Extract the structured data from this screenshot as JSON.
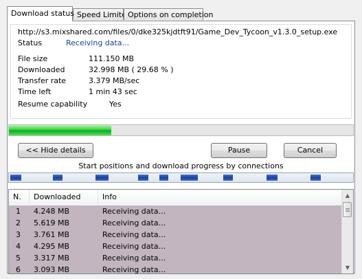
{
  "tabs": [
    {
      "label": "Download status",
      "active": true
    },
    {
      "label": "Speed Limiter",
      "active": false
    },
    {
      "label": "Options on completion",
      "active": false
    }
  ],
  "info": {
    "url": "http://s3.mixshared.com/files/0/dke325kjdtft91/Game_Dev_Tycoon_v1.3.0_setup.exe",
    "status_label": "Status",
    "status_value": "Receiving data...",
    "file_size_label": "File size",
    "file_size_value": "111.150  MB",
    "downloaded_label": "Downloaded",
    "downloaded_value": "32.998  MB  ( 29.68 % )",
    "transfer_rate_label": "Transfer rate",
    "transfer_rate_value": "3.379  MB/sec",
    "time_left_label": "Time left",
    "time_left_value": "1 min 43 sec",
    "resume_label": "Resume capability",
    "resume_value": "Yes"
  },
  "progress": {
    "fraction": 0.2968,
    "color": "#06b025"
  },
  "buttons": {
    "hide_details": "<< Hide details",
    "pause": "Pause",
    "cancel": "Cancel"
  },
  "connections_title": "Start positions and download progress by connections",
  "list": {
    "columns": [
      "N.",
      "Downloaded",
      "Info"
    ],
    "rows": [
      {
        "n": "1",
        "downloaded": "4.248  MB",
        "info": "Receiving data..."
      },
      {
        "n": "2",
        "downloaded": "5.619  MB",
        "info": "Receiving data..."
      },
      {
        "n": "3",
        "downloaded": "3.761  MB",
        "info": "Receiving data..."
      },
      {
        "n": "4",
        "downloaded": "4.295  MB",
        "info": "Receiving data..."
      },
      {
        "n": "5",
        "downloaded": "3.317  MB",
        "info": "Receiving data..."
      },
      {
        "n": "6",
        "downloaded": "3.093  MB",
        "info": "Receiving data..."
      }
    ]
  },
  "colors": {
    "status_text": "#1c3fa0",
    "row_selected": "#c2b5c0",
    "connection_segment": "#1d3f9a"
  }
}
